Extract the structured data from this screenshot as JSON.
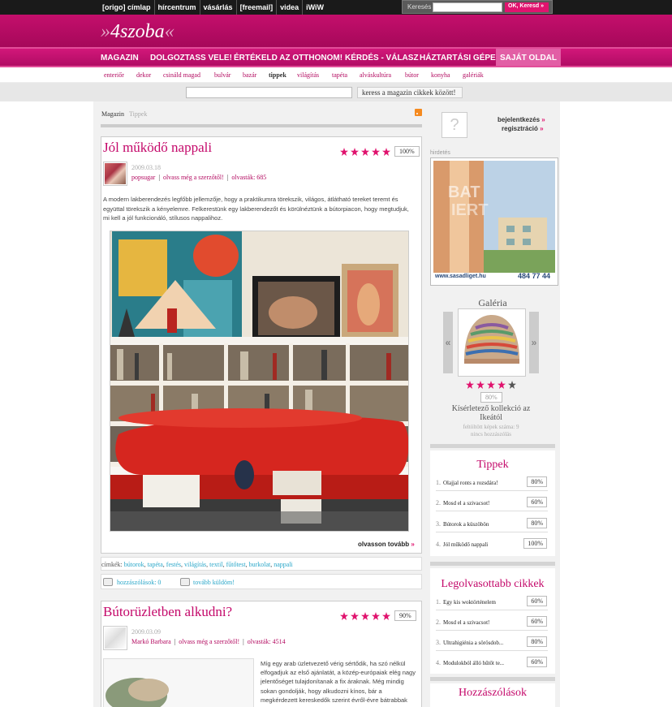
{
  "topnav": [
    "[origo] címlap",
    "hírcentrum",
    "vásárlás",
    "[freemail]",
    "videa",
    "iWiW"
  ],
  "topsearch": {
    "label": "Keresés",
    "button": "OK, Keresd"
  },
  "logo": {
    "arrows_left": "»",
    "text": "4szoba",
    "arrows_right": "«"
  },
  "mainnav": [
    "MAGAZIN",
    "DOLGOZTASS VELE!",
    "ÉRTÉKELD AZ OTTHONOM!",
    "KÉRDÉS - VÁLASZ",
    "HÁZTARTÁSI GÉPEK",
    "SAJÁT OLDAL"
  ],
  "subnav": [
    "enteriőr",
    "dekor",
    "csináld magad",
    "bulvár",
    "bazár",
    "tippek",
    "világítás",
    "tapéta",
    "alváskultúra",
    "bútor",
    "konyha",
    "galériák"
  ],
  "search": {
    "button": "keress a magazin cikkek között!"
  },
  "breadcrumb": {
    "a": "Magazin",
    "b": "Tippek"
  },
  "article1": {
    "title": "Jól működő nappali",
    "rating": "100%",
    "stars": 5,
    "date": "2009.03.18",
    "author": "popsugar",
    "author_link": "olvass még a szerzőtől!",
    "reads": "olvasták: 685",
    "excerpt": "A modern lakberendezés legfőbb jellemzője, hogy a praktikumra törekszik, világos, átlátható tereket teremt és együttal törekszik a kényelemre. Felkerestünk egy lakberendezőt és körülnéztünk a bútorpiacon, hogy megtudjuk, mi kell a jól funkcionáló, stílusos nappalihoz.",
    "more": "olvasson tovább",
    "tags_label": "címkék:",
    "tags": [
      "bútorok",
      "tapéta",
      "festés",
      "világítás",
      "textil",
      "fűtőtest",
      "burkolat",
      "nappali"
    ],
    "comments": "hozzászólások: 0",
    "send": "tovább küldöm!"
  },
  "article2": {
    "title": "Bútorüzletben alkudni?",
    "rating": "90%",
    "stars": 5,
    "date": "2009.03.09",
    "author": "Markó Barbara",
    "author_link": "olvass még a szerzőtől!",
    "reads": "olvasták: 4514",
    "excerpt": "Míg egy arab üzletvezető vérig sértődik, ha szó nélkül elfogadjuk az első ajánlatát, a közép-európaiak elég nagy jelentőséget tulajdonítanak a fix áraknak. Még mindig sokan gondolják, hogy alkudozni kínos, bár a megkérdezett kereskedők szerint évről-évre bátrabbak"
  },
  "login": {
    "login": "bejelentkezés",
    "register": "regisztráció"
  },
  "ad": {
    "label": "hirdetés",
    "url": "www.sasadliget.hu",
    "phone": "484 77 44",
    "overlay": "BAT",
    "overlay2": "IERT"
  },
  "gallery": {
    "title": "Galéria",
    "rating": "80%",
    "stars": 4,
    "caption": "Kísérletező kollekció az Ikeától",
    "count": "feltöltött képek száma: 9",
    "comments": "nincs hozzászólás"
  },
  "tippek": {
    "title": "Tippek",
    "items": [
      {
        "n": "1.",
        "t": "Olajjal ronts a rozsdára!",
        "p": "80%"
      },
      {
        "n": "2.",
        "t": "Mosd el a szivacsot!",
        "p": "60%"
      },
      {
        "n": "3.",
        "t": "Bútorok a küszöbön",
        "p": "80%"
      },
      {
        "n": "4.",
        "t": "Jól működő nappali",
        "p": "100%"
      }
    ]
  },
  "popular": {
    "title": "Legolvasottabb cikkek",
    "items": [
      {
        "n": "1.",
        "t": "Egy kis woktörténelem",
        "p": "60%"
      },
      {
        "n": "2.",
        "t": "Mosd el a szivacsot!",
        "p": "60%"
      },
      {
        "n": "3.",
        "t": "Ultrahigiénia a sörösdob...",
        "p": "80%"
      },
      {
        "n": "4.",
        "t": "Modulokból álló hűtőt te...",
        "p": "60%"
      }
    ]
  },
  "comments_box": {
    "title": "Hozzászólások"
  },
  "colors": {
    "brand": "#c40f6c",
    "accent": "#e0136e",
    "link_blue": "#2aa7c9"
  }
}
